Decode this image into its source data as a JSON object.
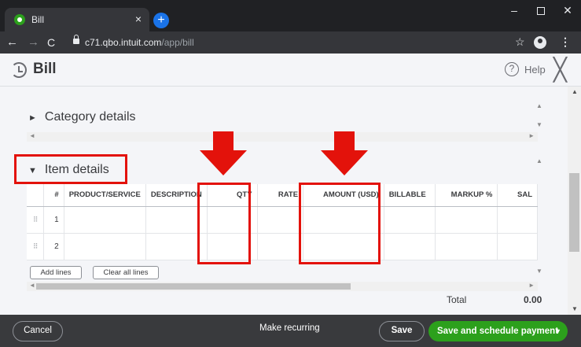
{
  "browser": {
    "tab_title": "Bill",
    "tab_close": "×",
    "new_tab": "+",
    "url_host": "c71.qbo.intuit.com",
    "url_path": "/app/bill",
    "window_controls": {
      "minimize": "–",
      "close": "✕"
    },
    "nav_icons": {
      "back": "←",
      "forward": "→",
      "reload": "C",
      "star": "☆",
      "menu": "⋮"
    }
  },
  "header": {
    "title": "Bill",
    "help_label": "Help",
    "help_symbol": "?",
    "close_symbol": "╳"
  },
  "sections": {
    "category": {
      "label": "Category details",
      "toggle": "►"
    },
    "item": {
      "label": "Item details",
      "toggle": "▼"
    }
  },
  "items_table": {
    "columns": [
      "#",
      "PRODUCT/SERVICE",
      "DESCRIPTION",
      "QTY",
      "RATE",
      "AMOUNT (USD)",
      "BILLABLE",
      "MARKUP %",
      "SAL"
    ],
    "rows": [
      {
        "num": "1",
        "product": "",
        "description": "",
        "qty": "",
        "rate": "",
        "amount": "",
        "billable": "",
        "markup": "",
        "sal": ""
      },
      {
        "num": "2",
        "product": "",
        "description": "",
        "qty": "",
        "rate": "",
        "amount": "",
        "billable": "",
        "markup": "",
        "sal": ""
      }
    ],
    "drag_handle": "⠿"
  },
  "buttons": {
    "add_lines": "Add lines",
    "clear_all_lines": "Clear all lines"
  },
  "total": {
    "label": "Total",
    "value": "0.00"
  },
  "footer": {
    "cancel": "Cancel",
    "make_recurring": "Make recurring",
    "save": "Save",
    "save_and_schedule": "Save and schedule payment",
    "split_caret": "▼"
  },
  "colors": {
    "brand_green": "#2ca01c",
    "annotation_red": "#e3120b",
    "footer_bg": "#393a3d"
  }
}
